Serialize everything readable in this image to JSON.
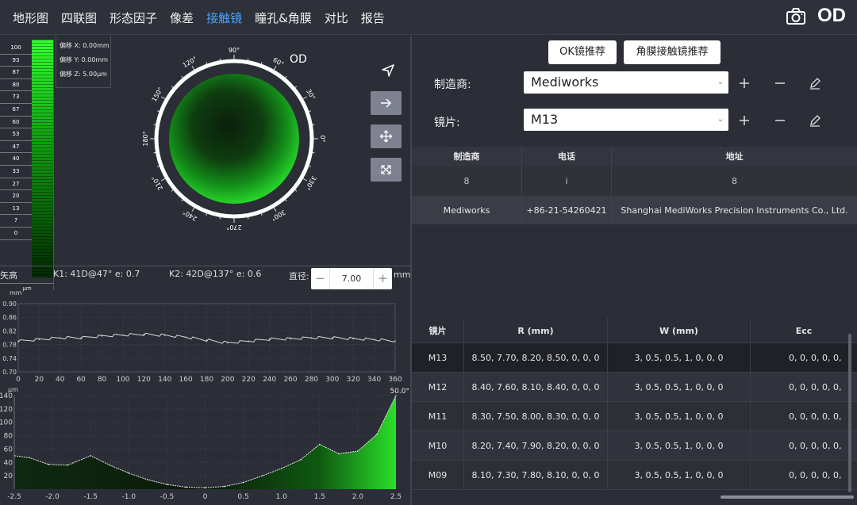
{
  "nav": {
    "tabs": [
      {
        "label": "地形图"
      },
      {
        "label": "四联图"
      },
      {
        "label": "形态因子"
      },
      {
        "label": "像差"
      },
      {
        "label": "接触镜"
      },
      {
        "label": "瞳孔&角膜"
      },
      {
        "label": "对比"
      },
      {
        "label": "报告"
      }
    ],
    "active_tab": "接触镜",
    "camera_icon": "camera-icon",
    "eye": "OD"
  },
  "scale": {
    "values": [
      "100",
      "93",
      "87",
      "80",
      "73",
      "67",
      "60",
      "53",
      "47",
      "40",
      "33",
      "27",
      "20",
      "13",
      "7",
      "0"
    ],
    "unit": "μm",
    "accent": "#1fd11f"
  },
  "offsets": {
    "x": "偏移 X: 0.00mm",
    "y": "偏移 Y: 0.00mm",
    "z": "偏移 Z: 5.00μm"
  },
  "map": {
    "eye": "OD",
    "angles": [
      "90°",
      "60°",
      "30°",
      "0°",
      "330°",
      "300°",
      "270°",
      "240°",
      "210°",
      "180°",
      "150°",
      "120°"
    ]
  },
  "tools": [
    "navigate-icon",
    "arrow-right-icon",
    "move-icon",
    "expand-icon"
  ],
  "sag": {
    "title": "矢高",
    "k1": "K1: 41D@47° e: 0.7",
    "k2": "K2: 42D@137° e: 0.6",
    "diameter_label": "直径:",
    "diameter_value": "7.00",
    "diameter_unit": "mm",
    "minus": "−",
    "plus": "+"
  },
  "chart_data": [
    {
      "type": "line",
      "ylabel": "mm",
      "xlim": [
        0,
        360
      ],
      "ylim": [
        0.7,
        0.9
      ],
      "x_ticks": [
        "0",
        "20",
        "40",
        "60",
        "80",
        "100",
        "120",
        "140",
        "160",
        "180",
        "200",
        "220",
        "240",
        "260",
        "280",
        "300",
        "320",
        "340",
        "360"
      ],
      "y_ticks": [
        "0.70",
        "0.74",
        "0.78",
        "0.82",
        "0.86",
        "0.90"
      ],
      "x": [
        0,
        20,
        40,
        60,
        80,
        100,
        120,
        140,
        160,
        180,
        200,
        220,
        240,
        260,
        280,
        300,
        320,
        340,
        360
      ],
      "values": [
        0.79,
        0.795,
        0.8,
        0.8,
        0.805,
        0.808,
        0.81,
        0.807,
        0.802,
        0.793,
        0.785,
        0.79,
        0.796,
        0.797,
        0.8,
        0.8,
        0.797,
        0.795,
        0.79
      ]
    },
    {
      "type": "area",
      "ylabel": "μm",
      "annotation": "50.0°",
      "xlim": [
        -2.5,
        2.5
      ],
      "ylim": [
        0,
        140
      ],
      "x_ticks": [
        "-2.5",
        "-2.0",
        "-1.5",
        "-1.0",
        "-0.5",
        "0",
        "0.5",
        "1.0",
        "1.5",
        "2.0",
        "2.5"
      ],
      "y_ticks": [
        "20",
        "40",
        "60",
        "80",
        "100",
        "120",
        "140"
      ],
      "x": [
        -2.5,
        -2.3,
        -2.05,
        -1.8,
        -1.5,
        -1.25,
        -1.0,
        -0.75,
        -0.5,
        -0.25,
        0.0,
        0.25,
        0.5,
        0.75,
        1.0,
        1.25,
        1.5,
        1.75,
        2.0,
        2.25,
        2.5
      ],
      "values": [
        50,
        47,
        37,
        36,
        50,
        36,
        24,
        14,
        7,
        3,
        2,
        4,
        10,
        20,
        31,
        44,
        67,
        53,
        57,
        82,
        140
      ]
    }
  ],
  "right": {
    "ok_button": "OK镜推荐",
    "cornea_button": "角膜接触镜推荐",
    "manufacturer_label": "制造商:",
    "manufacturer_value": "Mediworks",
    "lens_label": "镜片:",
    "lens_value": "M13",
    "manufacturers": {
      "headers": [
        "制造商",
        "电话",
        "地址"
      ],
      "rows": [
        [
          "8",
          "i",
          "8"
        ],
        [
          "Mediworks",
          "+86-21-54260421",
          "Shanghai MediWorks Precision Instruments Co., Ltd."
        ]
      ]
    },
    "lenses": {
      "headers": [
        "镜片",
        "R (mm)",
        "W (mm)",
        "Ecc"
      ],
      "rows": [
        [
          "M13",
          "8.50, 7.70, 8.20, 8.50, 0, 0, 0",
          "3, 0.5, 0.5, 1, 0, 0, 0",
          "0, 0, 0, 0, 0,"
        ],
        [
          "M12",
          "8.40, 7.60, 8.10, 8.40, 0, 0, 0",
          "3, 0.5, 0.5, 1, 0, 0, 0",
          "0, 0, 0, 0, 0,"
        ],
        [
          "M11",
          "8.30, 7.50, 8.00, 8.30, 0, 0, 0",
          "3, 0.5, 0.5, 1, 0, 0, 0",
          "0, 0, 0, 0, 0,"
        ],
        [
          "M10",
          "8.20, 7.40, 7.90, 8.20, 0, 0, 0",
          "3, 0.5, 0.5, 1, 0, 0, 0",
          "0, 0, 0, 0, 0,"
        ],
        [
          "M09",
          "8.10, 7.30, 7.80, 8.10, 0, 0, 0",
          "3, 0.5, 0.5, 1, 0, 0, 0",
          "0, 0, 0, 0, 0,"
        ]
      ]
    }
  }
}
